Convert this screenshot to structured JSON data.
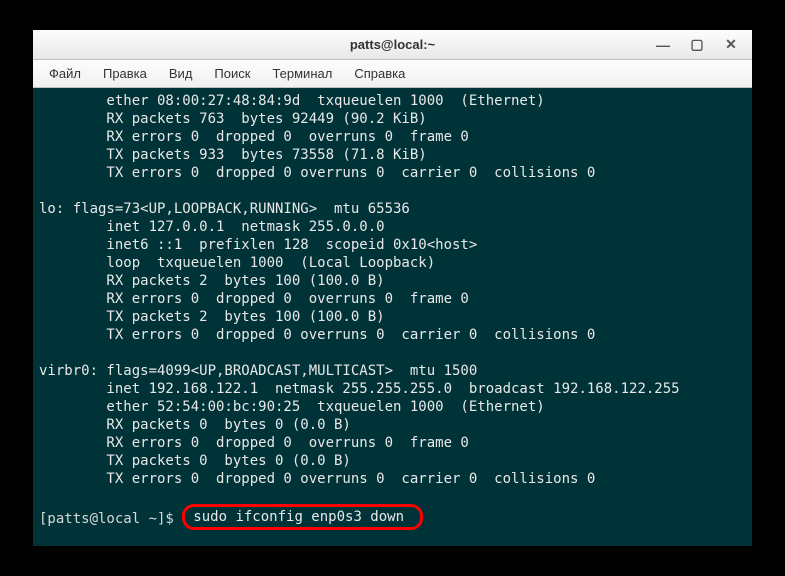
{
  "window": {
    "title": "patts@local:~"
  },
  "menubar": {
    "file": "Файл",
    "edit": "Правка",
    "view": "Вид",
    "search": "Поиск",
    "terminal": "Терминал",
    "help": "Справка"
  },
  "terminal": {
    "eth_line1": "        ether 08:00:27:48:84:9d  txqueuelen 1000  (Ethernet)",
    "eth_line2": "        RX packets 763  bytes 92449 (90.2 KiB)",
    "eth_line3": "        RX errors 0  dropped 0  overruns 0  frame 0",
    "eth_line4": "        TX packets 933  bytes 73558 (71.8 KiB)",
    "eth_line5": "        TX errors 0  dropped 0 overruns 0  carrier 0  collisions 0",
    "lo_line1": "lo: flags=73<UP,LOOPBACK,RUNNING>  mtu 65536",
    "lo_line2": "        inet 127.0.0.1  netmask 255.0.0.0",
    "lo_line3": "        inet6 ::1  prefixlen 128  scopeid 0x10<host>",
    "lo_line4": "        loop  txqueuelen 1000  (Local Loopback)",
    "lo_line5": "        RX packets 2  bytes 100 (100.0 B)",
    "lo_line6": "        RX errors 0  dropped 0  overruns 0  frame 0",
    "lo_line7": "        TX packets 2  bytes 100 (100.0 B)",
    "lo_line8": "        TX errors 0  dropped 0 overruns 0  carrier 0  collisions 0",
    "vb_line1": "virbr0: flags=4099<UP,BROADCAST,MULTICAST>  mtu 1500",
    "vb_line2": "        inet 192.168.122.1  netmask 255.255.255.0  broadcast 192.168.122.255",
    "vb_line3": "        ether 52:54:00:bc:90:25  txqueuelen 1000  (Ethernet)",
    "vb_line4": "        RX packets 0  bytes 0 (0.0 B)",
    "vb_line5": "        RX errors 0  dropped 0  overruns 0  frame 0",
    "vb_line6": "        TX packets 0  bytes 0 (0.0 B)",
    "vb_line7": "        TX errors 0  dropped 0 overruns 0  carrier 0  collisions 0",
    "prompt": "[patts@local ~]$ ",
    "command": "sudo ifconfig enp0s3 down"
  },
  "controls": {
    "minimize": "—",
    "maximize": "▢",
    "close": "✕"
  }
}
